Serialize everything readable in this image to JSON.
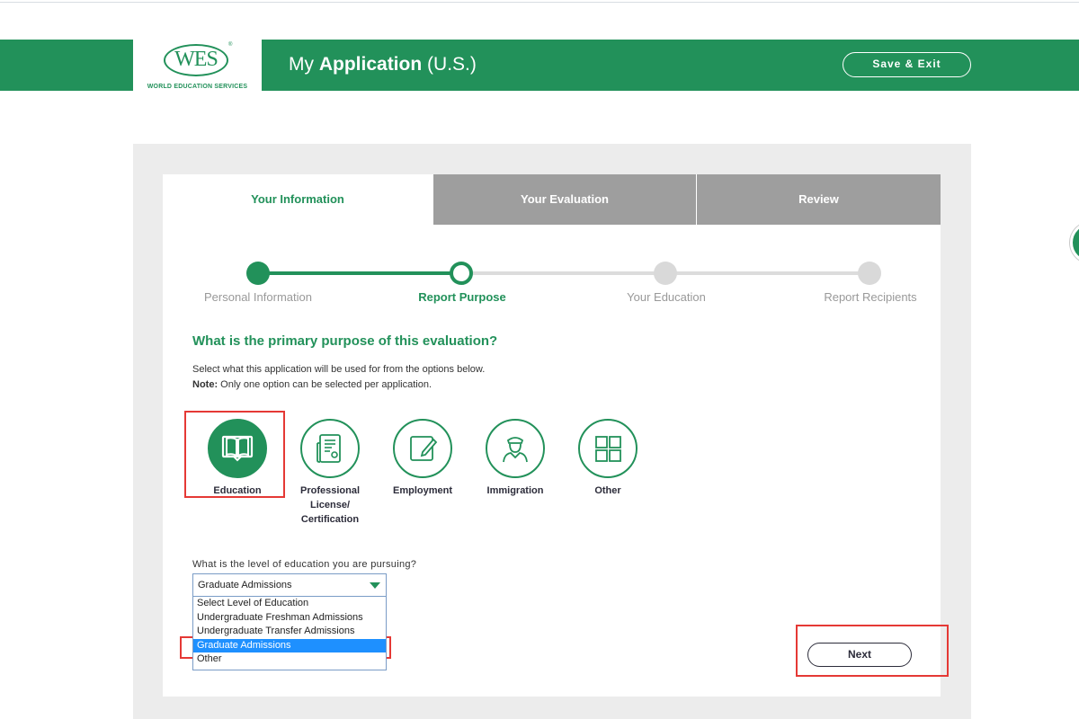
{
  "header": {
    "logo_text": "WES",
    "logo_reg": "®",
    "logo_subtitle": "WORLD EDUCATION SERVICES",
    "title_prefix": "My",
    "title_bold": "Application",
    "title_suffix": "(U.S.)",
    "save_exit_label": "Save & Exit"
  },
  "tabs": [
    {
      "label": "Your Information",
      "active": true
    },
    {
      "label": "Your Evaluation",
      "active": false
    },
    {
      "label": "Review",
      "active": false
    }
  ],
  "stepper": [
    {
      "label": "Personal Information",
      "state": "done"
    },
    {
      "label": "Report Purpose",
      "state": "current"
    },
    {
      "label": "Your Education",
      "state": "todo"
    },
    {
      "label": "Report Recipients",
      "state": "todo"
    }
  ],
  "question": "What is the primary purpose of this evaluation?",
  "instructions": "Select what this application will be used for from the options below.",
  "note_label": "Note:",
  "note_text": "Only one option can be selected per application.",
  "purposes": [
    {
      "label": "Education",
      "icon": "book-icon",
      "selected": true
    },
    {
      "label": "Professional License/ Certification",
      "icon": "certificate-icon",
      "selected": false
    },
    {
      "label": "Employment",
      "icon": "edit-document-icon",
      "selected": false
    },
    {
      "label": "Immigration",
      "icon": "officer-icon",
      "selected": false
    },
    {
      "label": "Other",
      "icon": "grid-icon",
      "selected": false
    }
  ],
  "education_level": {
    "question": "What is the level of education you are pursuing?",
    "selected_value": "Graduate Admissions",
    "options": [
      "Select Level of Education",
      "Undergraduate Freshman Admissions",
      "Undergraduate Transfer Admissions",
      "Graduate Admissions",
      "Other"
    ],
    "highlighted_index": 3
  },
  "next_label": "Next",
  "colors": {
    "brand_green": "#22915a",
    "tab_inactive": "#9e9e9e",
    "highlight": "#e53935",
    "option_selected": "#1e90ff"
  }
}
